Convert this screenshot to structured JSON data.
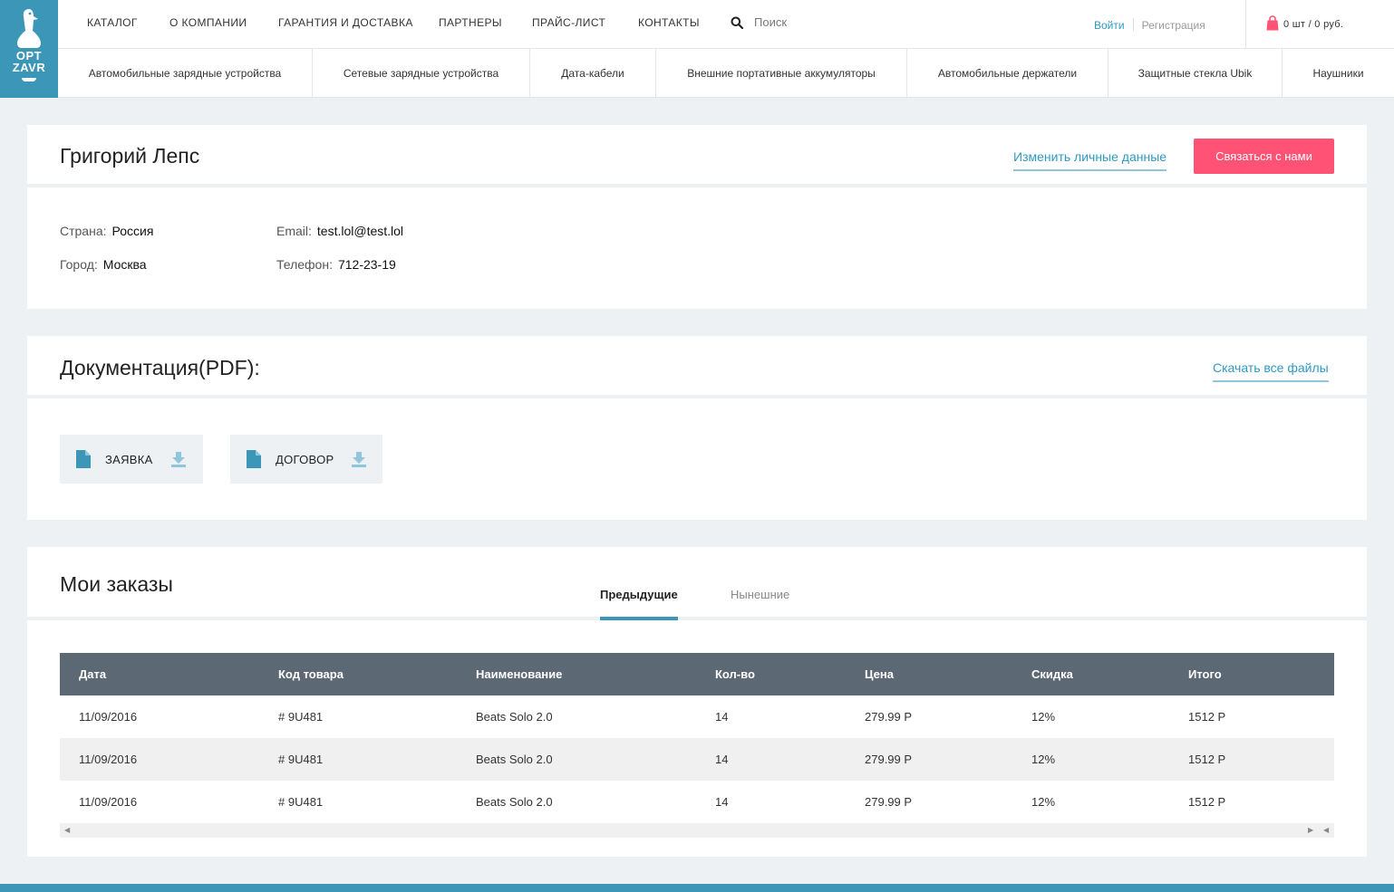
{
  "logo": {
    "line1": "OPT",
    "line2": "ZAVR"
  },
  "topnav": {
    "items": [
      "КАТАЛОГ",
      "О КОМПАНИИ",
      "ГАРАНТИЯ И ДОСТАВКА",
      "ПАРТНЕРЫ",
      "ПРАЙС-ЛИСТ",
      "КОНТАКТЫ"
    ],
    "search_placeholder": "Поиск",
    "login": "Войти",
    "register": "Регистрация",
    "cart": "0 шт / 0 руб."
  },
  "catnav": [
    "Автомобильные зарядные устройства",
    "Сетевые зарядные устройства",
    "Дата-кабели",
    "Внешние портативные аккумуляторы",
    "Автомобильные держатели",
    "Защитные стекла Ubik",
    "Наушники"
  ],
  "profile": {
    "name": "Григорий Лепс",
    "edit_link": "Изменить личные данные",
    "contact_button": "Связаться с нами",
    "country_label": "Страна:",
    "country": "Россия",
    "city_label": "Город:",
    "city": "Москва",
    "email_label": "Email:",
    "email": "test.lol@test.lol",
    "phone_label": "Телефон:",
    "phone": "712-23-19"
  },
  "docs": {
    "title": "Документация(PDF):",
    "download_all": "Скачать все файлы",
    "files": [
      "ЗАЯВКА",
      "ДОГОВОР"
    ]
  },
  "orders": {
    "title": "Мои заказы",
    "tabs": [
      "Предыдущие",
      "Нынешние"
    ],
    "active_tab": "Предыдущие",
    "columns": [
      "Дата",
      "Код товара",
      "Наименование",
      "Кол-во",
      "Цена",
      "Скидка",
      "Итого"
    ],
    "rows": [
      [
        "11/09/2016",
        "# 9U481",
        "Beats Solo 2.0",
        "14",
        "279.99 Р",
        "12%",
        "1512 Р"
      ],
      [
        "11/09/2016",
        "# 9U481",
        "Beats Solo 2.0",
        "14",
        "279.99 Р",
        "12%",
        "1512 Р"
      ],
      [
        "11/09/2016",
        "# 9U481",
        "Beats Solo 2.0",
        "14",
        "279.99 Р",
        "12%",
        "1512 Р"
      ]
    ]
  },
  "colors": {
    "accent": "#3b96b8",
    "pink": "#ff5274",
    "table_header": "#5c6975"
  }
}
